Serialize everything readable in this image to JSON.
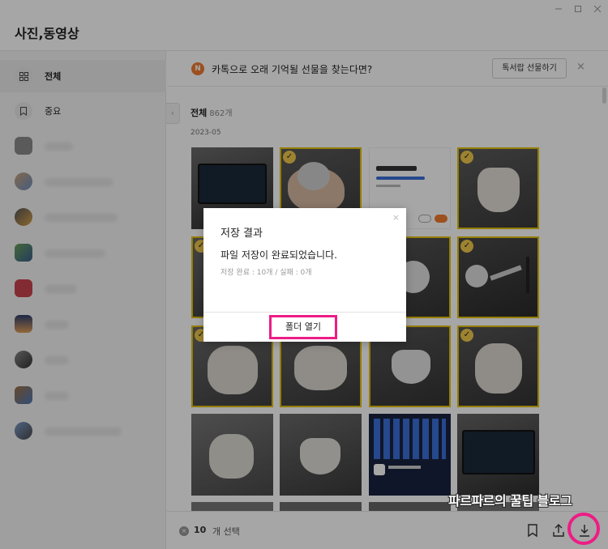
{
  "app": {
    "title": "사진,동영상"
  },
  "sidebar": {
    "items": [
      {
        "label": "전체",
        "icon": "grid-icon"
      },
      {
        "label": "중요",
        "icon": "bookmark-icon"
      }
    ]
  },
  "banner": {
    "logo_letter": "N",
    "text": "카톡으로 오래 기억될 선물을 찾는다면?",
    "button_label": "톡서랍 선물하기",
    "close_symbol": "×"
  },
  "content": {
    "section_title": "전체",
    "section_count": "862개",
    "date_label": "2023-05",
    "check_symbol": "✓"
  },
  "dialog": {
    "close_symbol": "×",
    "title": "저장 결과",
    "message": "파일 저장이 완료되었습니다.",
    "detail": "저장 완료 : 10개 / 실패 : 0개",
    "button_label": "폴더 열기"
  },
  "bottom_bar": {
    "clear_symbol": "×",
    "selected_count": "10",
    "selected_label": "개 선택"
  },
  "watermark": "파르파르의 꿀팁 블로그",
  "colors": {
    "highlight": "#ee1c86",
    "selected_outline": "#e3c100",
    "check_badge": "#f2c94c",
    "banner_logo": "#f07b2e"
  }
}
